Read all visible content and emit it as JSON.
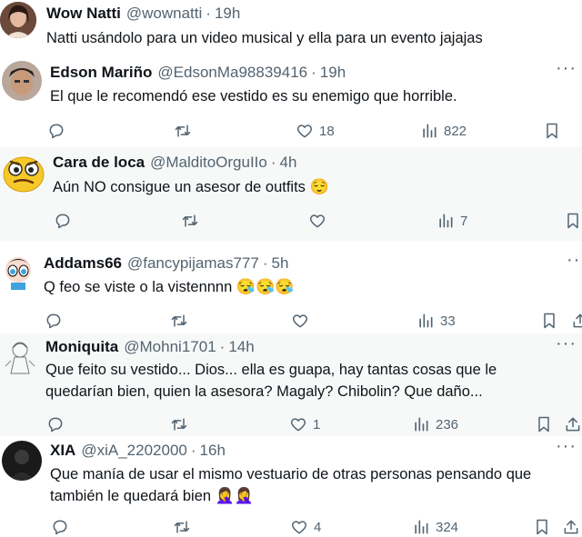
{
  "colors": {
    "text": "#0f1419",
    "secondary": "#536471",
    "alt_background": "#f7f9f9"
  },
  "tweets": [
    {
      "name": "Wow Natti",
      "handle": "@wownatti",
      "dot": "·",
      "time": "19h",
      "text": "Natti usándolo para un video musical y ella para un evento jajajas",
      "emoji": "",
      "avatar": "woman-photo"
    },
    {
      "name": "Edson Mariño",
      "handle": "@EdsonMa98839416",
      "dot": "·",
      "time": "19h",
      "text": "El que le recomendó ese vestido es su enemigo que horrible.",
      "emoji": "",
      "avatar": "man-photo",
      "stats": {
        "replies": "",
        "retweets": "",
        "likes": "18",
        "views": "822"
      }
    },
    {
      "name": "Cara de loca",
      "handle": "@MalditoOrguIIo",
      "dot": "·",
      "time": "4h",
      "text": "Aún NO consigue un asesor de outfits",
      "emoji": "😌",
      "avatar": "crazy-face-emoji",
      "stats": {
        "replies": "",
        "retweets": "",
        "likes": "",
        "views": "7"
      }
    },
    {
      "name": "Addams66",
      "handle": "@fancypijamas777",
      "dot": "·",
      "time": "5h",
      "text": "Q feo se viste o la vistennnn",
      "emoji": "😪😪😪",
      "avatar": "cartoon-girl",
      "stats": {
        "replies": "",
        "retweets": "",
        "likes": "",
        "views": "33"
      }
    },
    {
      "name": "Moniquita",
      "handle": "@Mohni1701",
      "dot": "·",
      "time": "14h",
      "text": "Que feito su vestido... Dios... ella es guapa, hay tantas cosas que le quedarían bien, quien la asesora? Magaly? Chibolin? Que daño...",
      "emoji": "",
      "avatar": "sketch-girl",
      "stats": {
        "replies": "",
        "retweets": "",
        "likes": "1",
        "views": "236"
      }
    },
    {
      "name": "XIA",
      "handle": "@xiA_2202000",
      "dot": "·",
      "time": "16h",
      "text": "Que manía de usar el mismo vestuario de otras personas pensando que también le quedará bien",
      "emoji": "🤦‍♀️🤦‍♀️",
      "avatar": "dark-photo",
      "stats": {
        "replies": "",
        "retweets": "",
        "likes": "4",
        "views": "324"
      }
    }
  ],
  "more_label": "···"
}
